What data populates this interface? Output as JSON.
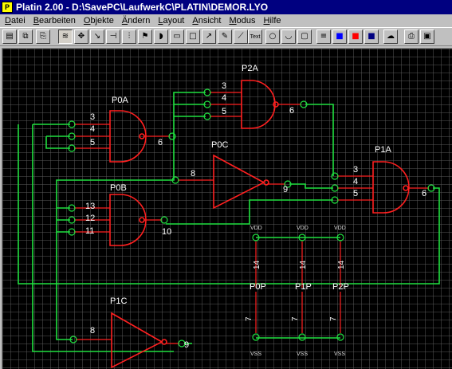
{
  "window": {
    "title": "Platin 2.00 - D:\\SavePC\\LaufwerkC\\PLATIN\\DEMOR.LYO",
    "icon_text": "P"
  },
  "menu": [
    "Datei",
    "Bearbeiten",
    "Objekte",
    "Ändern",
    "Layout",
    "Ansicht",
    "Modus",
    "Hilfe"
  ],
  "toolbar": {
    "buttons": [
      {
        "name": "new-page-icon",
        "glyph": "▤"
      },
      {
        "name": "copy-icon",
        "glyph": "⧉"
      },
      {
        "name": "paste-icon",
        "glyph": "⎘"
      },
      {
        "name": "stack-icon",
        "glyph": "≋",
        "pressed": true
      },
      {
        "name": "move-icon",
        "glyph": "✥"
      },
      {
        "name": "arrow-diagonal-icon",
        "glyph": "↘"
      },
      {
        "name": "pin-icon",
        "glyph": "⊣"
      },
      {
        "name": "vertical-pins-icon",
        "glyph": "⫶"
      },
      {
        "name": "flag-icon",
        "glyph": "⚑"
      },
      {
        "name": "gate-outline-icon",
        "glyph": "◗"
      },
      {
        "name": "bus-icon",
        "glyph": "▭"
      },
      {
        "name": "square-icon",
        "glyph": "□"
      },
      {
        "name": "line-arrow-icon",
        "glyph": "↗"
      },
      {
        "name": "pencil-icon",
        "glyph": "✎"
      },
      {
        "name": "wire-icon",
        "glyph": "⟋"
      },
      {
        "name": "text-tool",
        "text": "Text"
      },
      {
        "name": "circle-icon",
        "glyph": "○"
      },
      {
        "name": "arc-icon",
        "glyph": "◡"
      },
      {
        "name": "rectangle-icon",
        "glyph": "▢"
      },
      {
        "name": "lines-icon",
        "glyph": "≡"
      },
      {
        "name": "fill-blue-icon",
        "glyph": "■",
        "color": "#0000ff"
      },
      {
        "name": "fill-red-icon",
        "glyph": "■",
        "color": "#ff0000"
      },
      {
        "name": "fill-navy-icon",
        "glyph": "■",
        "color": "#000080"
      },
      {
        "name": "cloud-icon",
        "glyph": "☁"
      },
      {
        "name": "printer-icon",
        "glyph": "⎙"
      },
      {
        "name": "monitor-icon",
        "glyph": "▣"
      }
    ]
  },
  "schematic": {
    "colors": {
      "grid": "#5a5a5a",
      "gate": "#ff2020",
      "pin": "#ff2020",
      "wire": "#20e040",
      "text": "#ffffff",
      "small_text": "#dddddd"
    },
    "labels": {
      "p0a": "P0A",
      "p2a": "P2A",
      "p0c": "P0C",
      "p0b": "P0B",
      "p1a": "P1A",
      "p1c": "P1C",
      "p0p": "P0P",
      "p1p": "P1P",
      "p2p": "P2P",
      "vdd": "VDD",
      "vss": "VSS"
    },
    "pins": {
      "p0a_in": [
        "3",
        "4",
        "5"
      ],
      "p0a_out": "6",
      "p2a_in": [
        "3",
        "4",
        "5"
      ],
      "p2a_out": "6",
      "p0c_in": "8",
      "p0c_out": "9",
      "p0b_in": [
        "13",
        "12",
        "11"
      ],
      "p0b_out": "10",
      "p1a_in": [
        "3",
        "4",
        "5"
      ],
      "p1a_out": "6",
      "p1c_in": "8",
      "p1c_out": "9",
      "power_top": "14",
      "power_bottom": "7"
    }
  }
}
